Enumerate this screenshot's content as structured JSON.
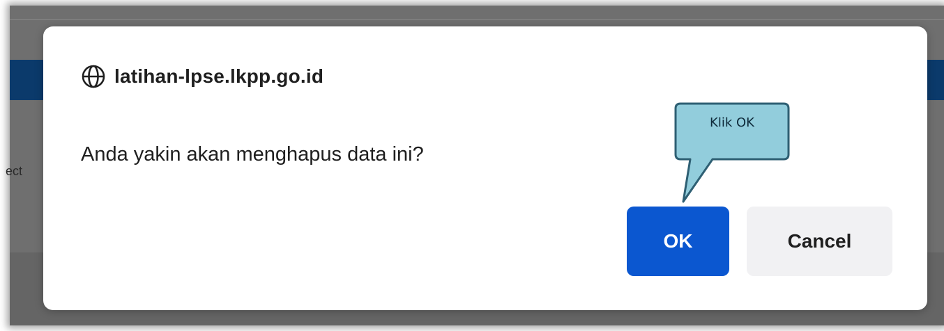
{
  "background": {
    "partial_text": "ect"
  },
  "dialog": {
    "origin": "latihan-lpse.lkpp.go.id",
    "origin_icon": "globe-icon",
    "message": "Anda yakin akan menghapus data ini?",
    "ok_label": "OK",
    "cancel_label": "Cancel"
  },
  "annotation": {
    "callout_text": "Klik OK"
  },
  "colors": {
    "ok_button": "#0b57d0",
    "cancel_button": "#f1f1f3",
    "callout_fill": "#92cddc",
    "callout_border": "#2e5f73",
    "backdrop": "#6f6f6f",
    "background_bar": "#0b3a6b"
  }
}
